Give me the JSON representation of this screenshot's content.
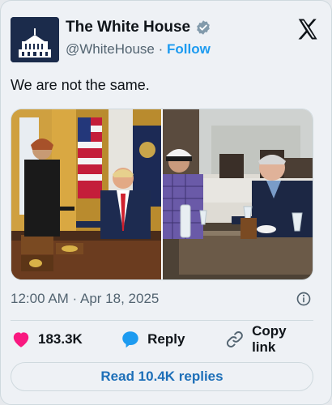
{
  "account": {
    "display_name": "The White House",
    "handle": "@WhiteHouse",
    "separator": "·",
    "follow_label": "Follow"
  },
  "tweet": {
    "text": "We are not the same.",
    "timestamp": "12:00 AM · Apr 18, 2025"
  },
  "actions": {
    "like_count": "183.3K",
    "reply_label": "Reply",
    "copy_link_label": "Copy link"
  },
  "read_replies_label": "Read 10.4K replies",
  "colors": {
    "accent": "#1d9bf0",
    "like": "#f91880",
    "verified": "#829aab"
  },
  "icons": {
    "verified": "verified-badge-icon",
    "x_logo": "x-logo-icon",
    "info": "info-icon",
    "like": "heart-icon",
    "reply": "speech-bubble-icon",
    "copy": "link-icon"
  }
}
